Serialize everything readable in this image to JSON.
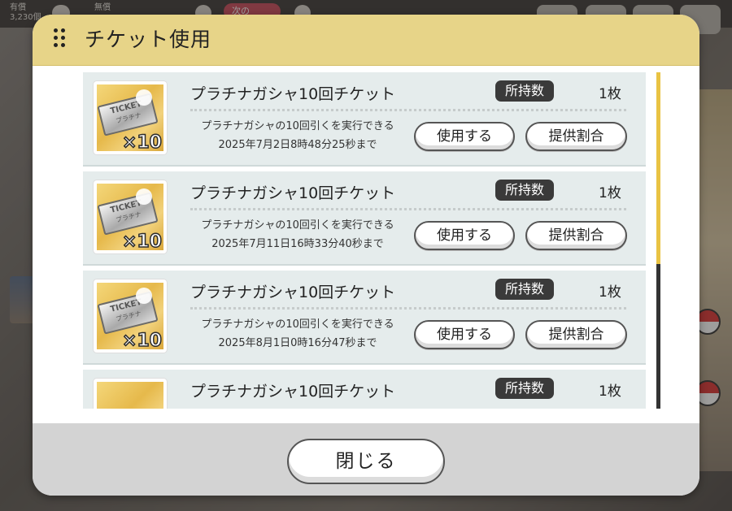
{
  "background": {
    "currency_paid_label": "有償",
    "currency_paid_value": "3,230個",
    "currency_free_label": "無償",
    "next_label": "次の"
  },
  "dialog": {
    "title": "チケット使用",
    "close_label": "閉じる",
    "tickets": [
      {
        "name": "プラチナガシャ10回チケット",
        "badge": "所持数",
        "count": "1枚",
        "description": "プラチナガシャの10回引くを実行できる",
        "expiry": "2025年7月2日8時48分25秒まで",
        "use_label": "使用する",
        "rate_label": "提供割合",
        "image_text": "TICKET",
        "image_sub": "プラチナ",
        "image_mult": "×10"
      },
      {
        "name": "プラチナガシャ10回チケット",
        "badge": "所持数",
        "count": "1枚",
        "description": "プラチナガシャの10回引くを実行できる",
        "expiry": "2025年7月11日16時33分40秒まで",
        "use_label": "使用する",
        "rate_label": "提供割合",
        "image_text": "TICKET",
        "image_sub": "プラチナ",
        "image_mult": "×10"
      },
      {
        "name": "プラチナガシャ10回チケット",
        "badge": "所持数",
        "count": "1枚",
        "description": "プラチナガシャの10回引くを実行できる",
        "expiry": "2025年8月1日0時16分47秒まで",
        "use_label": "使用する",
        "rate_label": "提供割合",
        "image_text": "TICKET",
        "image_sub": "プラチナ",
        "image_mult": "×10"
      },
      {
        "name": "プラチナガシャ10回チケット",
        "badge": "所持数",
        "count": "1枚"
      }
    ]
  },
  "colors": {
    "header": "#e7d488",
    "row": "#e5ecec",
    "badge": "#3a3a3a",
    "scroll_thumb": "#e9c343",
    "footer": "#d3d3d3"
  }
}
